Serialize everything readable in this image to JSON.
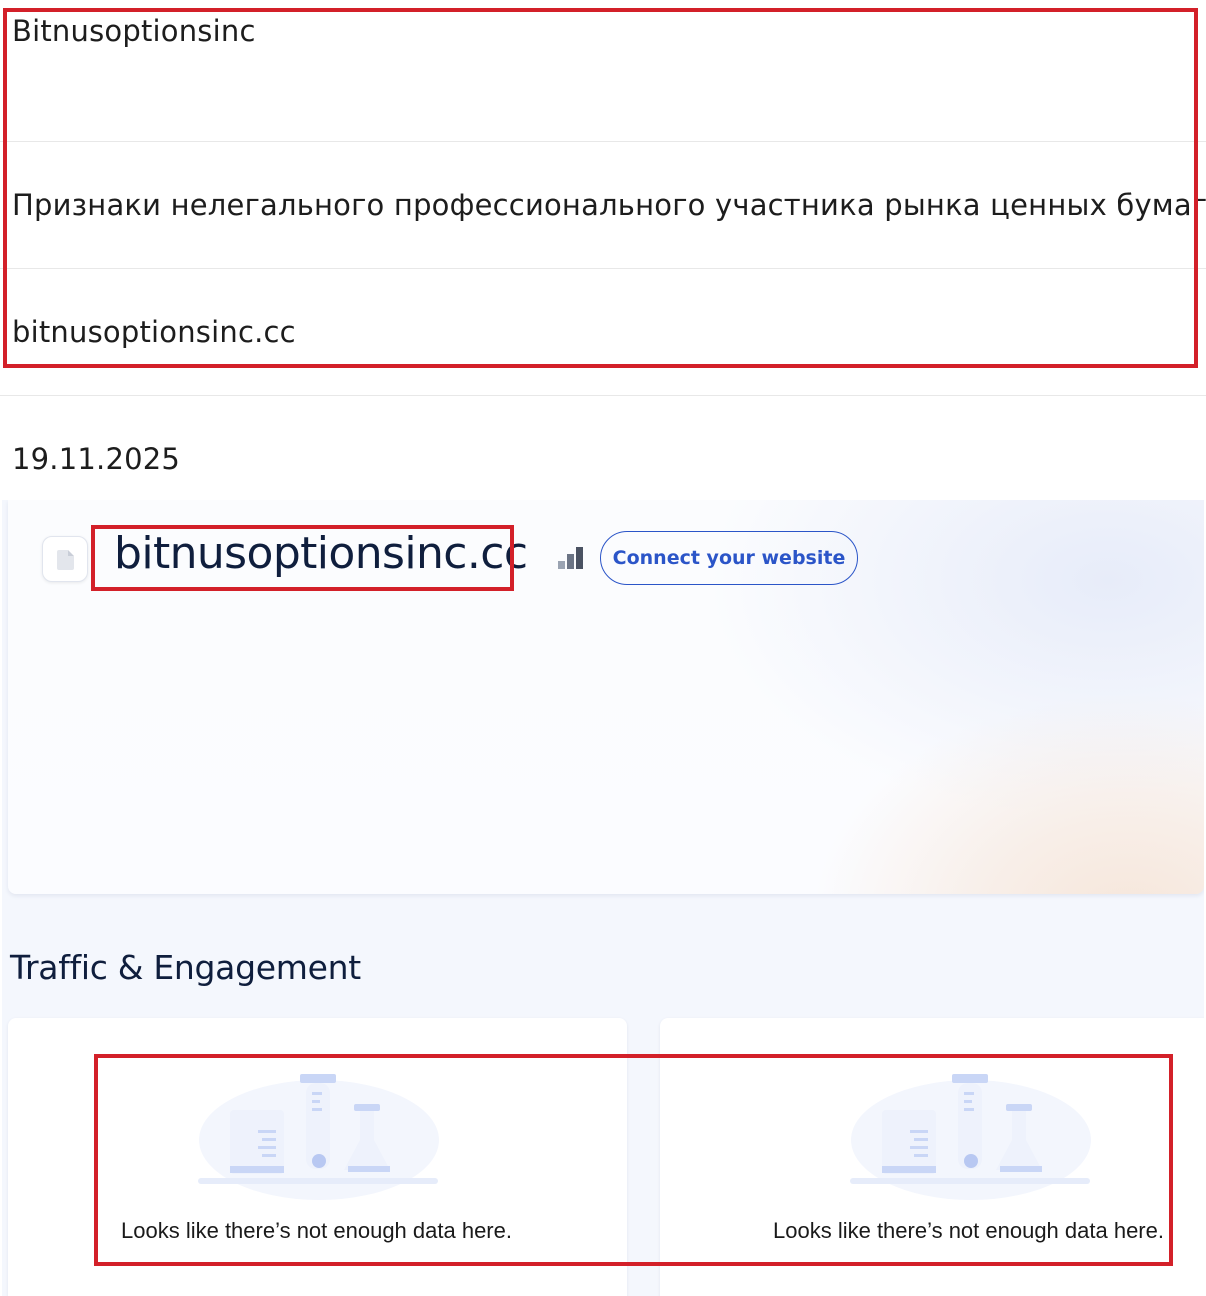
{
  "info": {
    "company_name": "Bitnusoptionsinc",
    "violation": "Признаки нелегального профессионального участника рынка ценных бумаг",
    "domain": "bitnusoptionsinc.cc",
    "date": "19.11.2025"
  },
  "screenshot": {
    "domain_title": "bitnusoptionsinc.cc",
    "connect_button": "Connect your website",
    "section_title": "Traffic & Engagement",
    "cards": [
      {
        "empty_message": "Looks like there’s not enough data here."
      },
      {
        "empty_message": "Looks like there’s not enough data here."
      }
    ]
  },
  "colors": {
    "highlight_border": "#d32029",
    "accent_blue": "#2b55c8",
    "title_navy": "#0f1e3d"
  }
}
